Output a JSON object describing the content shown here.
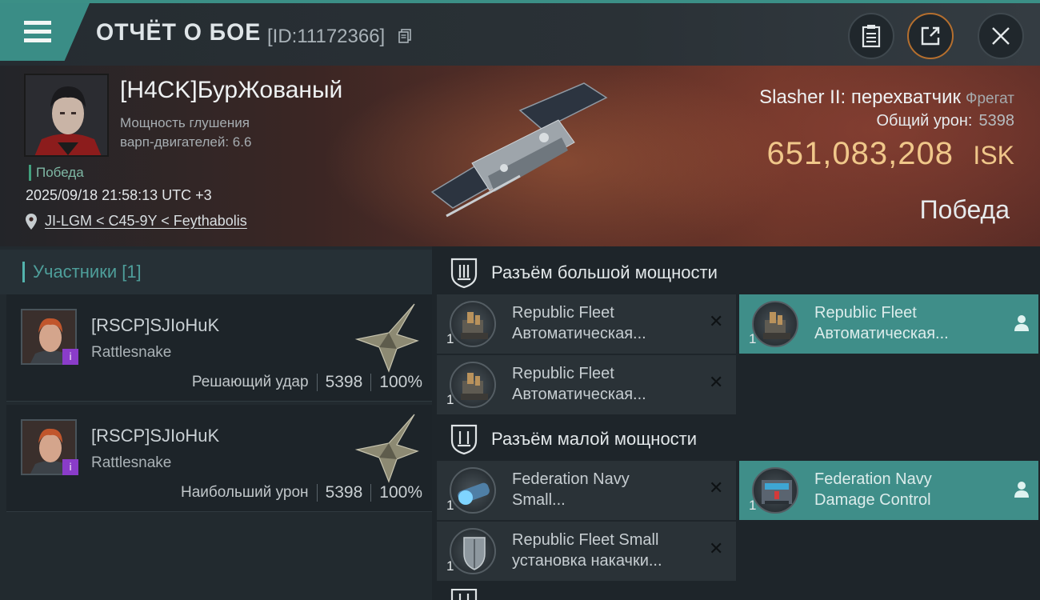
{
  "header": {
    "title": "ОТЧЁТ О БОЕ",
    "report_id": "[ID:11172366]",
    "icons": [
      "menu-icon",
      "copy-icon",
      "clipboard-icon",
      "share-icon",
      "close-icon"
    ]
  },
  "victim": {
    "pilot": "[H4CK]БурЖованый",
    "stat_line1": "Мощность глушения",
    "stat_line2": "варп-двигателей: 6.6",
    "status": "Победа",
    "datetime": "2025/09/18 21:58:13 UTC +3",
    "location": "JI-LGM < C45-9Y < Feythabolis",
    "ship": "Slasher II: перехватчик",
    "ship_class": "Фрегат",
    "total_damage_label": "Общий урон:",
    "total_damage": "5398",
    "isk_value": "651,083,208",
    "isk_unit": "ISK",
    "result": "Победа"
  },
  "participants": {
    "header": "Участники [1]",
    "rows": [
      {
        "corp_name": "[RSCP]SJIoHuK",
        "ship": "Rattlesnake",
        "role": "Решающий удар",
        "damage": "5398",
        "percent": "100%"
      },
      {
        "corp_name": "[RSCP]SJIoHuK",
        "ship": "Rattlesnake",
        "role": "Наибольший урон",
        "damage": "5398",
        "percent": "100%"
      }
    ]
  },
  "fitting": {
    "high_slot_label": "Разъём большой мощности",
    "low_slot_label": "Разъём малой мощности",
    "high_modules": [
      {
        "name1": "Republic Fleet",
        "name2": "Автоматическая...",
        "qty": "1",
        "state": "destroyed"
      },
      {
        "name1": "Republic Fleet",
        "name2": "Автоматическая...",
        "qty": "1",
        "state": "dropped"
      },
      {
        "name1": "Republic Fleet",
        "name2": "Автоматическая...",
        "qty": "1",
        "state": "destroyed"
      }
    ],
    "low_modules": [
      {
        "name1": "Federation Navy",
        "name2": "Small...",
        "qty": "1",
        "state": "destroyed"
      },
      {
        "name1": "Federation Navy",
        "name2": "Damage Control",
        "qty": "1",
        "state": "dropped"
      },
      {
        "name1": "Republic Fleet Small",
        "name2": "установка накачки...",
        "qty": "1",
        "state": "destroyed"
      }
    ]
  },
  "colors": {
    "accent_teal": "#3a8d86",
    "isk_gold": "#f0c78a",
    "victory_green": "#41a07d"
  }
}
